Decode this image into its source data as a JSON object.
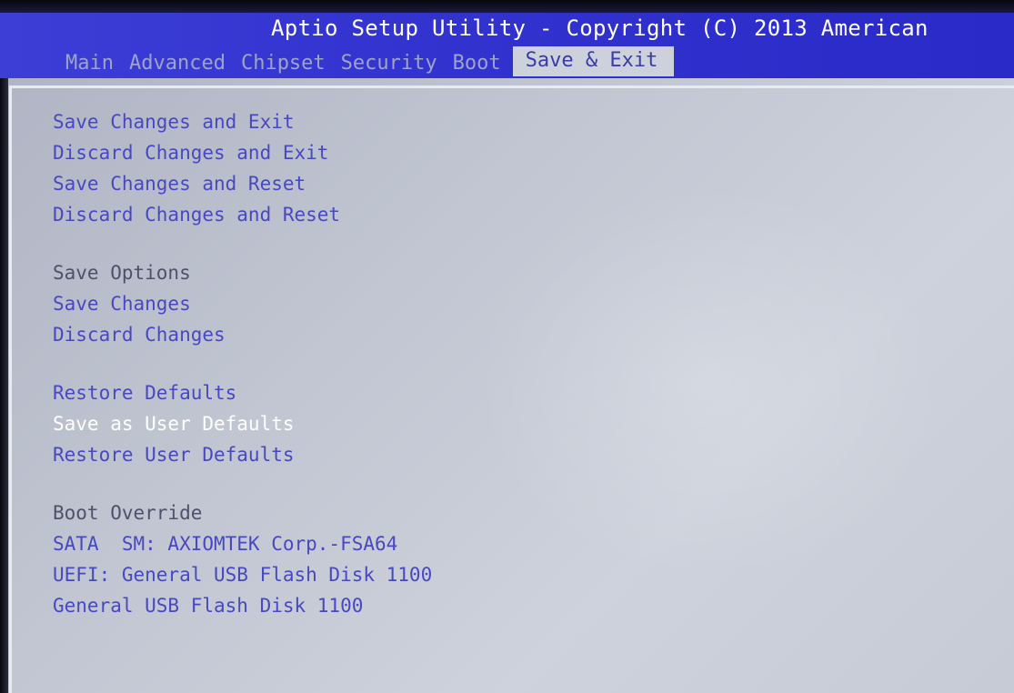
{
  "header": {
    "title": "Aptio Setup Utility - Copyright (C) 2013 American"
  },
  "tabs": [
    {
      "label": "Main",
      "active": false
    },
    {
      "label": "Advanced",
      "active": false
    },
    {
      "label": "Chipset",
      "active": false
    },
    {
      "label": "Security",
      "active": false
    },
    {
      "label": "Boot",
      "active": false
    },
    {
      "label": "Save & Exit",
      "active": true
    }
  ],
  "menu": {
    "items": [
      {
        "label": "Save Changes and Exit"
      },
      {
        "label": "Discard Changes and Exit"
      },
      {
        "label": "Save Changes and Reset"
      },
      {
        "label": "Discard Changes and Reset"
      },
      {
        "label": "Save Options"
      },
      {
        "label": "Save Changes"
      },
      {
        "label": "Discard Changes"
      },
      {
        "label": "Restore Defaults"
      },
      {
        "label": "Save as User Defaults",
        "highlighted": true
      },
      {
        "label": "Restore User Defaults"
      },
      {
        "label": "Boot Override"
      },
      {
        "label": "SATA  SM: AXIOMTEK Corp.-FSA64"
      },
      {
        "label": "UEFI: General USB Flash Disk 1100"
      },
      {
        "label": "General USB Flash Disk 1100"
      }
    ]
  },
  "colors": {
    "header_bg": "#3434d0",
    "title_text": "#ffffff",
    "tab_inactive": "#9ea4c8",
    "tab_active_bg": "#cdd1dc",
    "tab_active_text": "#3a3aa8",
    "panel_bg": "#c4c9d4",
    "item_text": "#4848c0",
    "section_header_text": "#50506a",
    "highlight_text": "#ffffff"
  }
}
